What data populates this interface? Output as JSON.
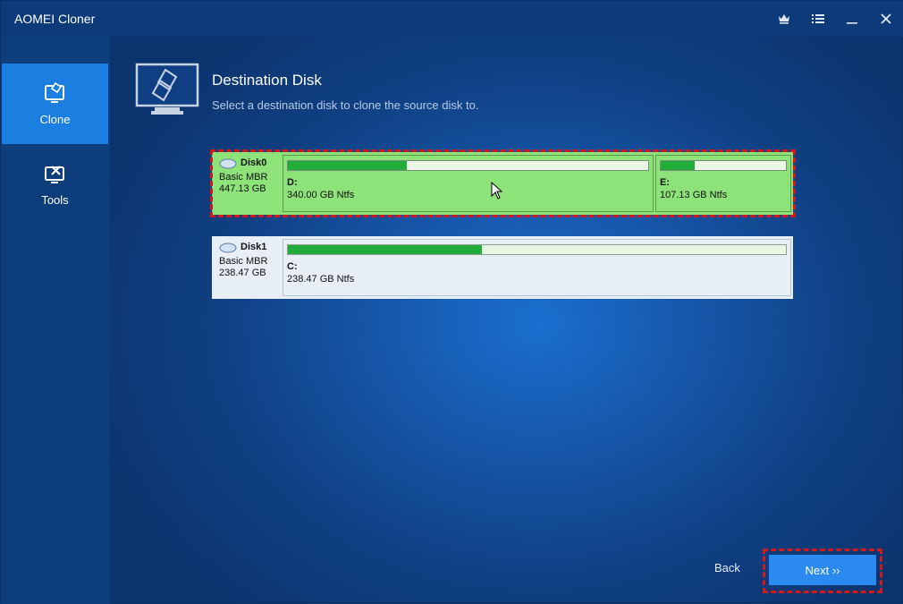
{
  "app": {
    "title": "AOMEI Cloner"
  },
  "titlebar_icons": [
    "crown-icon",
    "menu-list-icon",
    "minimize-icon",
    "close-icon"
  ],
  "sidebar": {
    "items": [
      {
        "label": "Clone",
        "icon": "clone-icon",
        "active": true
      },
      {
        "label": "Tools",
        "icon": "tools-icon",
        "active": false
      }
    ]
  },
  "header": {
    "title": "Destination Disk",
    "subtitle": "Select a destination disk to clone the source disk to."
  },
  "disks": [
    {
      "name": "Disk0",
      "type": "Basic MBR",
      "size": "447.13 GB",
      "selected": true,
      "partitions": [
        {
          "label": "D:",
          "detail": "340.00 GB Ntfs",
          "used_fraction": 0.33
        },
        {
          "label": "E:",
          "detail": "107.13 GB Ntfs",
          "used_fraction": 0.27
        }
      ]
    },
    {
      "name": "Disk1",
      "type": "Basic MBR",
      "size": "238.47 GB",
      "selected": false,
      "partitions": [
        {
          "label": "C:",
          "detail": "238.47 GB Ntfs",
          "used_fraction": 0.39
        }
      ]
    }
  ],
  "footer": {
    "back_label": "Back",
    "next_label": "Next ››"
  },
  "colors": {
    "accent": "#1b7fe2",
    "selected_disk": "#8ee27a",
    "usage_fill": "#22ad3a",
    "highlight": "#d11a1a"
  }
}
